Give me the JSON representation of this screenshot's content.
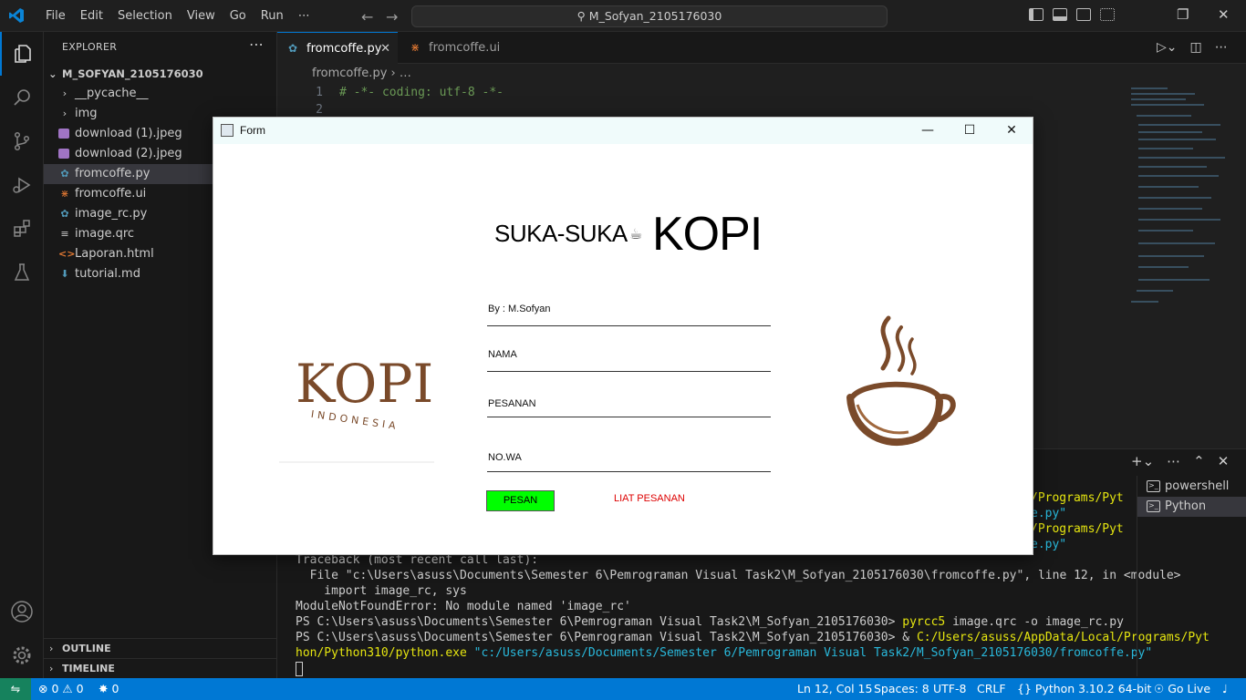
{
  "titlebar": {
    "menu": [
      "File",
      "Edit",
      "Selection",
      "View",
      "Go",
      "Run",
      "⋯"
    ],
    "search": "M_Sofyan_2105176030"
  },
  "sidebar": {
    "title": "EXPLORER",
    "folder": "M_SOFYAN_2105176030",
    "items": [
      {
        "label": "__pycache__",
        "icon": "chevron-right-icon"
      },
      {
        "label": "img",
        "icon": "chevron-right-icon"
      },
      {
        "label": "download (1).jpeg",
        "icon": "image-file-icon"
      },
      {
        "label": "download (2).jpeg",
        "icon": "image-file-icon"
      },
      {
        "label": "fromcoffe.py",
        "icon": "python-file-icon"
      },
      {
        "label": "fromcoffe.ui",
        "icon": "rss-file-icon"
      },
      {
        "label": "image_rc.py",
        "icon": "python-file-icon"
      },
      {
        "label": "image.qrc",
        "icon": "text-file-icon"
      },
      {
        "label": "Laporan.html",
        "icon": "html-file-icon"
      },
      {
        "label": "tutorial.md",
        "icon": "markdown-file-icon"
      }
    ],
    "outline": "OUTLINE",
    "timeline": "TIMELINE"
  },
  "tabs": [
    {
      "label": "fromcoffe.py",
      "active": true
    },
    {
      "label": "fromcoffe.ui",
      "active": false
    }
  ],
  "breadcrumb": {
    "file": "fromcoffe.py",
    "rest": "› …"
  },
  "code": {
    "lines": [
      {
        "n": "1",
        "text": "# -*- coding: utf-8 -*-"
      },
      {
        "n": "2",
        "text": ""
      }
    ]
  },
  "terminal": {
    "partial": [
      {
        "tail": "/Programs/Pyt"
      },
      {
        "tail": "e.py\""
      },
      {
        "tail": "/Programs/Pyt"
      },
      {
        "tail": "e.py\""
      }
    ],
    "lines": [
      "Traceback (most recent call last):",
      "  File \"c:\\Users\\asuss\\Documents\\Semester 6\\Pemrograman Visual Task2\\M_Sofyan_2105176030\\fromcoffe.py\", line 12, in <module>",
      "    import image_rc, sys",
      "ModuleNotFoundError: No module named 'image_rc'"
    ],
    "prompt": "PS C:\\Users\\asuss\\Documents\\Semester 6\\Pemrograman Visual Task2\\M_Sofyan_2105176030>",
    "cmd1": "pyrcc5",
    "cmd1_args": " image.qrc -o image_rc.py",
    "amp": " & ",
    "cmd2_path_a": "C:/Users/asuss/AppData/Local/Programs/Pyt",
    "cmd2_path_b": "hon/Python310/python.exe",
    "cmd2_arg": " \"c:/Users/asuss/Documents/Semester 6/Pemrograman Visual Task2/M_Sofyan_2105176030/fromcoffe.py\"",
    "shells": [
      "powershell",
      "Python"
    ]
  },
  "form": {
    "title": "Form",
    "hero_small": "SUKA-SUKA",
    "hero_cup": "☕",
    "hero_big": "KOPI",
    "by": "By : M.Sofyan",
    "fields": [
      "NAMA",
      "PESANAN",
      "NO.WA"
    ],
    "pesan_button": "PESAN",
    "liat_link": "LIAT PESANAN",
    "logo_word": "KOPI",
    "logo_sub": "INDONESIA"
  },
  "statusbar": {
    "errors": "0",
    "warnings": "0",
    "ports": "0",
    "position": "Ln 12, Col 15",
    "spaces": "Spaces: 8",
    "encoding": "UTF-8",
    "eol": "CRLF",
    "language": "Python",
    "interpreter": "3.10.2 64-bit",
    "golive": "Go Live"
  },
  "colors": {
    "accent": "#0078d4",
    "pesan_button": "#00ff00",
    "link_red": "#dd0000",
    "coffee_brown": "#7a4a2a"
  }
}
